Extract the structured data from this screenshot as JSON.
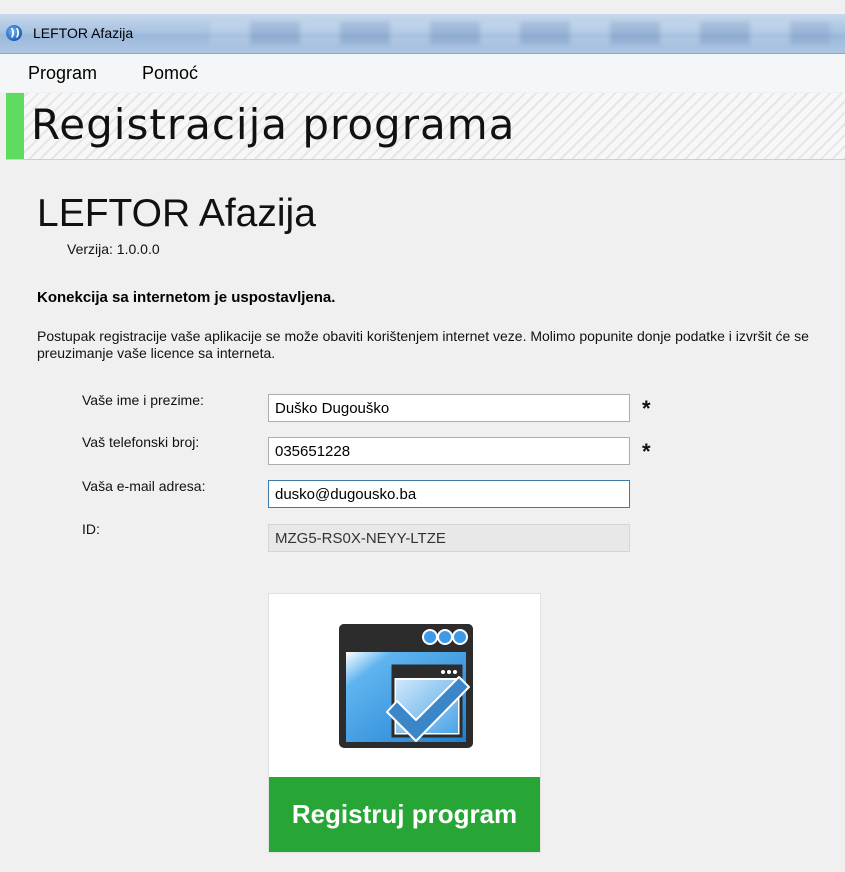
{
  "window": {
    "title": "LEFTOR Afazija"
  },
  "menu": {
    "items": [
      "Program",
      "Pomoć"
    ]
  },
  "header": {
    "title": "Registracija programa"
  },
  "app": {
    "name": "LEFTOR Afazija",
    "version": "Verzija: 1.0.0.0"
  },
  "status": {
    "text": "Konekcija sa internetom je uspostavljena."
  },
  "description": {
    "text": "Postupak registracije vaše aplikacije se može obaviti korištenjem internet veze. Molimo popunite donje podatke i izvršit će se preuzimanje vaše licence sa interneta."
  },
  "form": {
    "fields": [
      {
        "label": "Vaše ime i prezime:",
        "value": "Duško Dugouško",
        "required_mark": "*"
      },
      {
        "label": "Vaš telefonski broj:",
        "value": "035651228",
        "required_mark": "*"
      },
      {
        "label": "Vaša e-mail adresa:",
        "value": "dusko@dugousko.ba",
        "required_mark": ""
      },
      {
        "label": "ID:",
        "value": "MZG5-RS0X-NEYY-LTZE",
        "required_mark": ""
      }
    ]
  },
  "register_button": {
    "label": "Registruj program",
    "icon": "window-checkmark-icon"
  },
  "colors": {
    "accent_green": "#5fdc5f",
    "button_green": "#27a636",
    "icon_blue": "#2f8fd8"
  }
}
